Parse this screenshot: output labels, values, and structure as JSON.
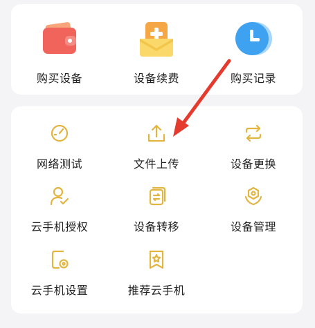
{
  "colors": {
    "icon_gold": "#E2B440",
    "arrow_red": "#E53A2E",
    "wallet_red": "#F0645C",
    "renew_orange": "#F5A645",
    "clock_blue": "#3FA2F0"
  },
  "top_menu": [
    {
      "label": "购买设备",
      "icon": "wallet-icon"
    },
    {
      "label": "设备续费",
      "icon": "renew-plus-icon"
    },
    {
      "label": "购买记录",
      "icon": "clock-icon"
    }
  ],
  "grid_menu": [
    {
      "label": "网络测试",
      "icon": "speedometer-icon"
    },
    {
      "label": "文件上传",
      "icon": "upload-icon"
    },
    {
      "label": "设备更换",
      "icon": "swap-icon"
    },
    {
      "label": "云手机授权",
      "icon": "user-authorize-icon"
    },
    {
      "label": "设备转移",
      "icon": "transfer-icon"
    },
    {
      "label": "设备管理",
      "icon": "manage-icon"
    },
    {
      "label": "云手机设置",
      "icon": "settings-icon"
    },
    {
      "label": "推荐云手机",
      "icon": "recommend-icon"
    }
  ]
}
